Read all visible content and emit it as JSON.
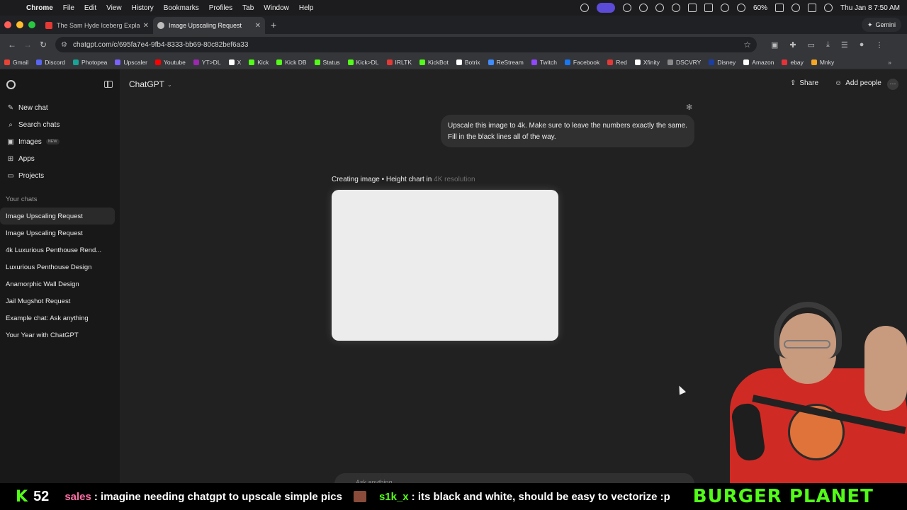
{
  "menubar": {
    "app_name": "Chrome",
    "items": [
      "File",
      "Edit",
      "View",
      "History",
      "Bookmarks",
      "Profiles",
      "Tab",
      "Window",
      "Help"
    ],
    "battery": "60%",
    "clock": "Thu Jan 8  7:50 AM"
  },
  "tabs": [
    {
      "title": "The Sam Hyde Iceberg Explai",
      "favicon_color": "#e53935"
    },
    {
      "title": "Image Upscaling Request",
      "favicon_color": "#bdbdbd"
    }
  ],
  "gemini_label": "Gemini",
  "omnibox": {
    "url": "chatgpt.com/c/695fa7e4-9fb4-8333-bb69-80c82bef6a33"
  },
  "bookmarks": [
    {
      "label": "Gmail",
      "color": "#ea4335"
    },
    {
      "label": "Discord",
      "color": "#5865f2"
    },
    {
      "label": "Photopea",
      "color": "#18a497"
    },
    {
      "label": "Upscaler",
      "color": "#7b61ff"
    },
    {
      "label": "Youtube",
      "color": "#ff0000"
    },
    {
      "label": "YT>DL",
      "color": "#9c27b0"
    },
    {
      "label": "X",
      "color": "#ffffff"
    },
    {
      "label": "Kick",
      "color": "#53fc18"
    },
    {
      "label": "Kick DB",
      "color": "#53fc18"
    },
    {
      "label": "Status",
      "color": "#53fc18"
    },
    {
      "label": "Kick>DL",
      "color": "#53fc18"
    },
    {
      "label": "IRLTK",
      "color": "#e53935"
    },
    {
      "label": "KickBot",
      "color": "#53fc18"
    },
    {
      "label": "Botrix",
      "color": "#ffffff"
    },
    {
      "label": "ReStream",
      "color": "#3f8cff"
    },
    {
      "label": "Twitch",
      "color": "#9146ff"
    },
    {
      "label": "Facebook",
      "color": "#1877f2"
    },
    {
      "label": "Red",
      "color": "#e53935"
    },
    {
      "label": "Xfinity",
      "color": "#ffffff"
    },
    {
      "label": "DSCVRY",
      "color": "#888888"
    },
    {
      "label": "Disney",
      "color": "#1a3ea3"
    },
    {
      "label": "Amazon",
      "color": "#ffffff"
    },
    {
      "label": "ebay",
      "color": "#e53238"
    },
    {
      "label": "Mnky",
      "color": "#f5a623"
    }
  ],
  "sidebar": {
    "actions": [
      {
        "label": "New chat",
        "icon": "edit-icon",
        "glyph": "✎"
      },
      {
        "label": "Search chats",
        "icon": "search-icon",
        "glyph": "⌕"
      },
      {
        "label": "Images",
        "icon": "image-icon",
        "glyph": "▣",
        "badge": "NEW"
      },
      {
        "label": "Apps",
        "icon": "apps-icon",
        "glyph": "⊞"
      },
      {
        "label": "Projects",
        "icon": "folder-icon",
        "glyph": "▭"
      }
    ],
    "section_label": "Your chats",
    "chats": [
      "Image Upscaling Request",
      "Image Upscaling Request",
      "4k Luxurious Penthouse Rend...",
      "Luxurious Penthouse Design",
      "Anamorphic Wall Design",
      "Jail Mugshot Request",
      "Example chat: Ask anything",
      "Your Year with ChatGPT"
    ]
  },
  "header": {
    "model": "ChatGPT",
    "share": "Share",
    "add_people": "Add people"
  },
  "conversation": {
    "user_message": "Upscale this image to 4k. Make sure to leave the numbers exactly the same. Fill in the black lines all of the way.",
    "status_prefix": "Creating image • Height chart in",
    "status_suffix": "4K resolution"
  },
  "composer": {
    "placeholder": "Ask anything"
  },
  "ticker": {
    "viewer_count": "52",
    "messages": [
      {
        "user": "sales",
        "text": ": imagine needing chatgpt to upscale simple pics",
        "color": "#ff6fa8"
      },
      {
        "user": "s1k_x",
        "text": ": its black and white, should be easy to vectorize :p",
        "color": "#53fc18"
      }
    ],
    "brand": "BURGER PLANET"
  }
}
